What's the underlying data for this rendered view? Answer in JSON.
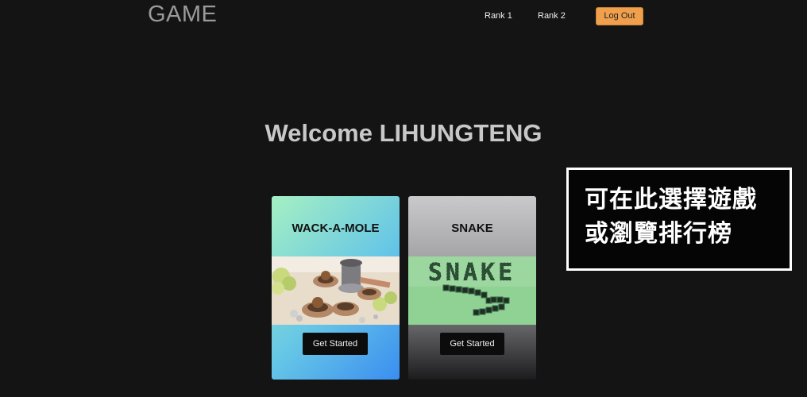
{
  "header": {
    "brand": "GAME",
    "nav": [
      "Rank 1",
      "Rank 2"
    ],
    "logout_label": "Log Out"
  },
  "main": {
    "welcome": "Welcome LIHUNGTENG",
    "cards": [
      {
        "title": "WACK-A-MOLE",
        "button": "Get Started"
      },
      {
        "title": "SNAKE",
        "image_text": "SNAKE",
        "button": "Get Started"
      }
    ]
  },
  "overlay": {
    "lines": [
      "可在此選擇遊戲",
      "或瀏覽排行榜"
    ]
  },
  "colors": {
    "background": "#141414",
    "logout_button": "#f0a04d",
    "overlay_border": "#ffffff"
  }
}
